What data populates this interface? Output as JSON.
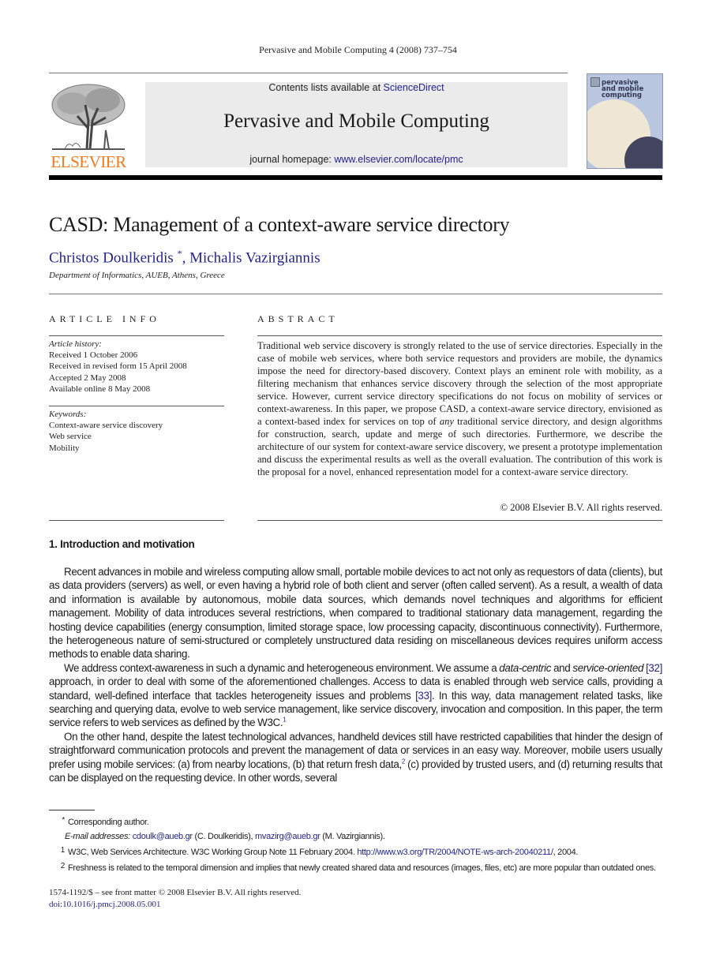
{
  "running_head": "Pervasive and Mobile Computing 4 (2008) 737–754",
  "masthead": {
    "publisher_logo_text": "ELSEVIER",
    "contents_prefix": "Contents lists available at ",
    "contents_link": "ScienceDirect",
    "journal_title": "Pervasive and Mobile Computing",
    "homepage_prefix": "journal homepage: ",
    "homepage_link": "www.elsevier.com/locate/pmc",
    "cover_title_lines": [
      "pervasive",
      "and mobile",
      "computing"
    ],
    "colors": {
      "elsevier_orange": "#f07a1c",
      "link_blue": "#23238e",
      "banner_gray": "#ebebeb"
    }
  },
  "article": {
    "title": "CASD: Management of a context-aware service directory",
    "authors": [
      {
        "name": "Christos Doulkeridis",
        "mark": "*"
      },
      {
        "name": "Michalis Vazirgiannis",
        "mark": ""
      }
    ],
    "author_separator": ", ",
    "affiliation": "Department of Informatics, AUEB, Athens, Greece"
  },
  "article_info": {
    "heading": "ARTICLE INFO",
    "history_label": "Article history:",
    "history": [
      "Received 1 October 2006",
      "Received in revised form 15 April 2008",
      "Accepted 2 May 2008",
      "Available online 8 May 2008"
    ],
    "keywords_label": "Keywords:",
    "keywords": [
      "Context-aware service discovery",
      "Web service",
      "Mobility"
    ]
  },
  "abstract": {
    "heading": "ABSTRACT",
    "text_before_italic": "Traditional web service discovery is strongly related to the use of service directories. Especially in the case of mobile web services, where both service requestors and providers are mobile, the dynamics impose the need for directory-based discovery. Context plays an eminent role with mobility, as a filtering mechanism that enhances service discovery through the selection of the most appropriate service. However, current service directory specifications do not focus on mobility of services or context-awareness. In this paper, we propose CASD, a context-aware service directory, envisioned as a context-based index for services on top of ",
    "italic_word": "any",
    "text_after_italic": " traditional service directory, and design algorithms for construction, search, update and merge of such directories. Furthermore, we describe the architecture of our system for context-aware service discovery, we present a prototype implementation and discuss the experimental results as well as the overall evaluation. The contribution of this work is the proposal for a novel, enhanced representation model for a context-aware service directory.",
    "copyright": "© 2008 Elsevier B.V. All rights reserved."
  },
  "section1": {
    "title": "1.  Introduction and motivation",
    "p1": "Recent advances in mobile and wireless computing allow small, portable mobile devices to act not only as requestors of data (clients), but as data providers (servers) as well, or even having a hybrid role of both client and server (often called servent). As a result, a wealth of data and information is available by autonomous, mobile data sources, which demands novel techniques and algorithms for efficient management. Mobility of data introduces several restrictions, when compared to traditional stationary data management, regarding the hosting device capabilities (energy consumption, limited storage space, low processing capacity, discontinuous connectivity). Furthermore, the heterogeneous nature of semi-structured or completely unstructured data residing on miscellaneous devices requires uniform access methods to enable data sharing.",
    "p2": {
      "a": "We address context-awareness in such a dynamic and heterogeneous environment. We assume a ",
      "i1": "data-centric",
      "b": " and ",
      "i2": "service-oriented",
      "c": " ",
      "ref1": "[32]",
      "d": " approach, in order to deal with some of the aforementioned challenges. Access to data is enabled through web service calls, providing a standard, well-defined interface that tackles heterogeneity issues and problems ",
      "ref2": "[33]",
      "e": ". In this way, data management related tasks, like searching and querying data, evolve to web service management, like service discovery, invocation and composition. In this paper, the term service refers to web services as defined by the W3C.",
      "fn": "1"
    },
    "p3": {
      "a": "On the other hand, despite the latest technological advances, handheld devices still have restricted capabilities that hinder the design of straightforward communication protocols and prevent the management of data or services in an easy way. Moreover, mobile users usually prefer using mobile services: (a) from nearby locations, (b) that return fresh data,",
      "fn": "2",
      "b": " (c) provided by trusted users, and (d) returning results that can be displayed on the requesting device. In other words, several"
    }
  },
  "footnotes": {
    "corresponding_mark": "*",
    "corresponding": "Corresponding author.",
    "email_label": "E-mail addresses:",
    "email1": "cdoulk@aueb.gr",
    "email1_owner": " (C. Doulkeridis), ",
    "email2": "mvazirg@aueb.gr",
    "email2_owner": " (M. Vazirgiannis).",
    "fn1_mark": "1",
    "fn1_text": "W3C, Web Services Architecture. W3C Working Group Note 11 February 2004. ",
    "fn1_link": "http://www.w3.org/TR/2004/NOTE-ws-arch-20040211/",
    "fn1_tail": ", 2004.",
    "fn2_mark": "2",
    "fn2_text": "Freshness is related to the temporal dimension and implies that newly created shared data and resources (images, files, etc) are more popular than outdated ones."
  },
  "front_matter": {
    "issn_line": "1574-1192/$ – see front matter © 2008 Elsevier B.V. All rights reserved.",
    "doi": "doi:10.1016/j.pmcj.2008.05.001"
  }
}
